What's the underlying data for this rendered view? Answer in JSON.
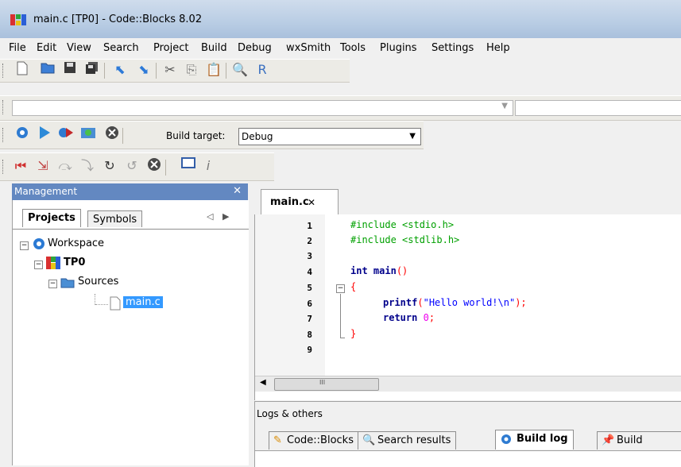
{
  "window": {
    "title": "main.c [TP0] - Code::Blocks 8.02"
  },
  "menu": [
    "File",
    "Edit",
    "View",
    "Search",
    "Project",
    "Build",
    "Debug",
    "wxSmith",
    "Tools",
    "Plugins",
    "Settings",
    "Help"
  ],
  "build_toolbar": {
    "target_label": "Build target:",
    "target_value": "Debug"
  },
  "management": {
    "title": "Management",
    "close": "✕",
    "tabs": [
      "Projects",
      "Symbols"
    ],
    "tree": {
      "workspace": "Workspace",
      "project": "TP0",
      "folder": "Sources",
      "file": "main.c"
    }
  },
  "editor": {
    "tab_label": "main.c",
    "tab_close": "✕",
    "line_numbers": [
      "1",
      "2",
      "3",
      "4",
      "5",
      "6",
      "7",
      "8",
      "9"
    ],
    "fold_marker": "−",
    "code": {
      "l1_dir": "#include",
      "l1_hdr": " <stdio.h>",
      "l2_dir": "#include",
      "l2_hdr": " <stdlib.h>",
      "l4_kw": "int",
      "l4_rest": " main",
      "l4_paren": "()",
      "l5_brace": "{",
      "l6_fn": "printf",
      "l6_open": "(",
      "l6_str": "\"Hello world!\\n\"",
      "l6_close": ");",
      "l7_kw": "return",
      "l7_num": " 0",
      "l7_semi": ";",
      "l8_brace": "}"
    },
    "hscroll_grip": "III"
  },
  "logs": {
    "title": "Logs & others",
    "tabs": [
      "Code::Blocks",
      "Search results",
      "Build log",
      "Build messa"
    ]
  }
}
